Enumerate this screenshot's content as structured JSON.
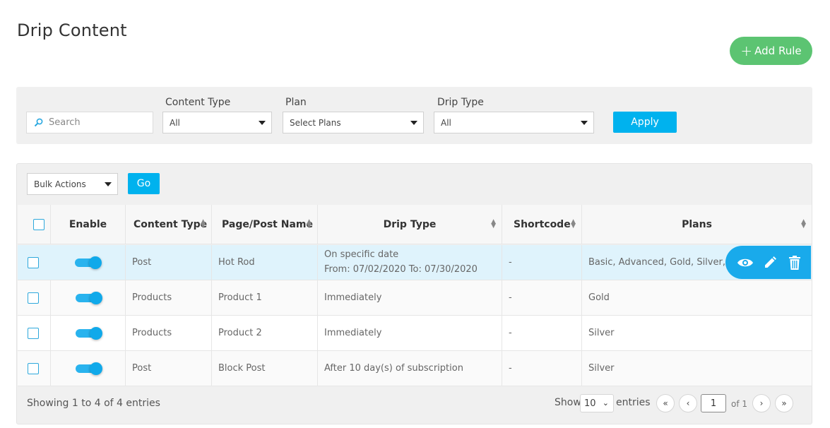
{
  "page": {
    "title": "Drip Content",
    "add_rule_label": "Add Rule"
  },
  "filters": {
    "search_placeholder": "Search",
    "content_type": {
      "label": "Content Type",
      "value": "All"
    },
    "plan": {
      "label": "Plan",
      "value": "Select Plans"
    },
    "drip_type": {
      "label": "Drip Type",
      "value": "All"
    },
    "apply_label": "Apply"
  },
  "bulk": {
    "value": "Bulk Actions",
    "go_label": "Go"
  },
  "table": {
    "headers": {
      "enable": "Enable",
      "content_type": "Content Type",
      "page_post_name": "Page/Post Name",
      "drip_type": "Drip Type",
      "shortcode": "Shortcode",
      "plans": "Plans"
    },
    "rows": [
      {
        "content_type": "Post",
        "name": "Hot Rod",
        "drip_type": "On specific date",
        "drip_detail": "From: 07/02/2020 To: 07/30/2020",
        "shortcode": "-",
        "plans": "Basic, Advanced, Gold, Silver, Tes",
        "enabled": true
      },
      {
        "content_type": "Products",
        "name": "Product 1",
        "drip_type": "Immediately",
        "drip_detail": "",
        "shortcode": "-",
        "plans": "Gold",
        "enabled": true
      },
      {
        "content_type": "Products",
        "name": "Product 2",
        "drip_type": "Immediately",
        "drip_detail": "",
        "shortcode": "-",
        "plans": "Silver",
        "enabled": true
      },
      {
        "content_type": "Post",
        "name": "Block Post",
        "drip_type": "After 10 day(s) of subscription",
        "drip_detail": "",
        "shortcode": "-",
        "plans": "Silver",
        "enabled": true
      }
    ]
  },
  "footer": {
    "info": "Showing 1 to 4 of 4 entries",
    "show_label": "Show",
    "page_length": "10",
    "entries_label": "entries",
    "current_page": "1",
    "of_label": "of 1"
  },
  "colors": {
    "accent": "#00b2ee",
    "add_button": "#5cc472",
    "highlight_row": "#dff3fc"
  },
  "icons": {
    "row_actions": [
      "eye-icon",
      "pencil-icon",
      "trash-icon"
    ]
  }
}
